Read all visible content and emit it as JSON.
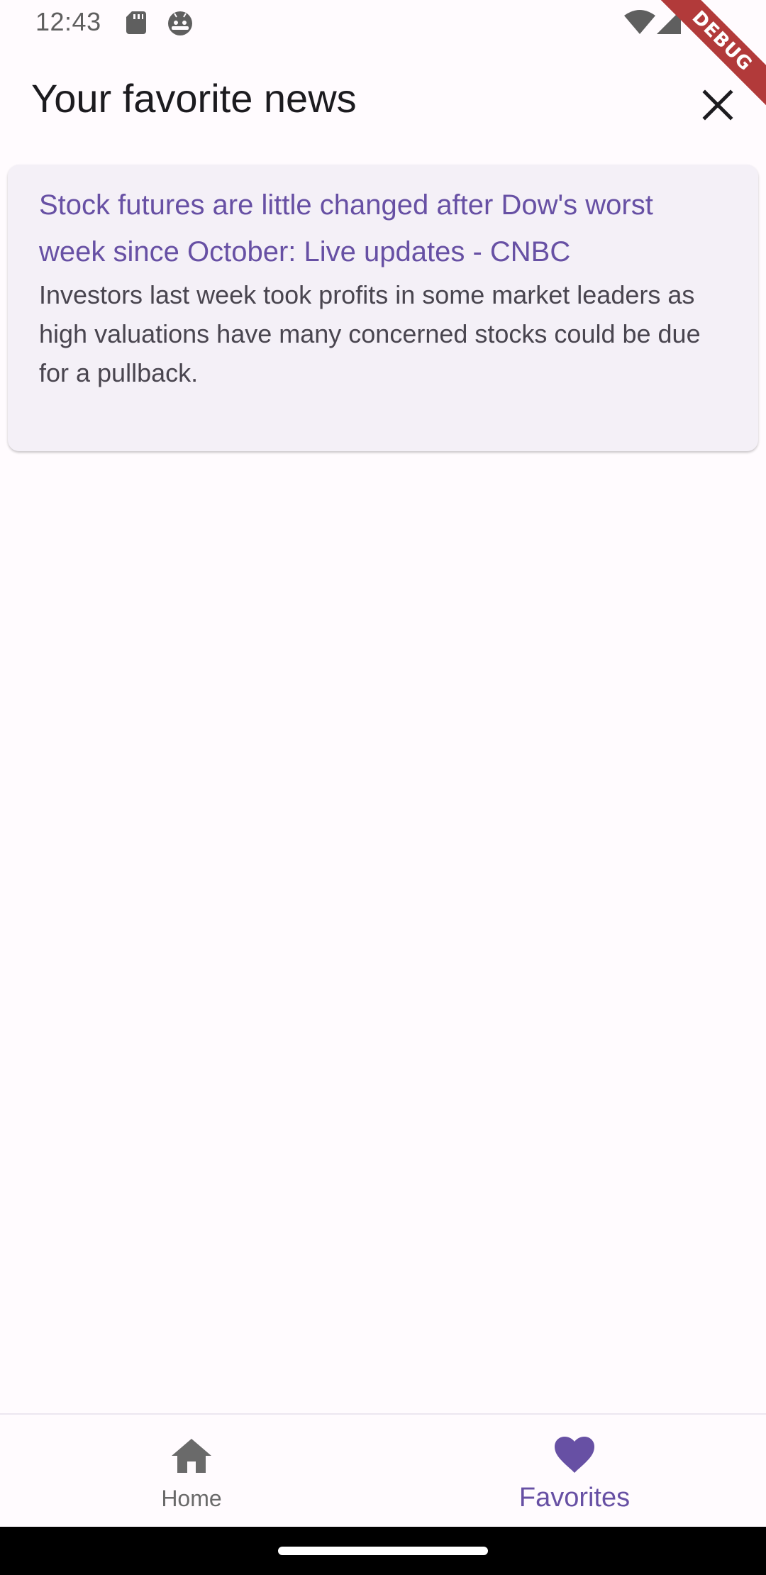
{
  "status_bar": {
    "time": "12:43",
    "icons": [
      "sd-card-icon",
      "android-icon",
      "wifi-icon",
      "signal-icon",
      "battery-icon"
    ]
  },
  "debug_banner": {
    "label": "DEBUG"
  },
  "app_bar": {
    "title": "Your favorite news",
    "close_icon": "close-icon"
  },
  "favorites": [
    {
      "title": "Stock futures are little changed after Dow's worst week since October: Live updates - CNBC",
      "description": "Investors last week took profits in some market leaders as high valuations have many concerned stocks could be due for a pullback."
    }
  ],
  "bottom_nav": {
    "items": [
      {
        "label": "Home",
        "icon": "home-icon",
        "selected": false
      },
      {
        "label": "Favorites",
        "icon": "heart-icon",
        "selected": true
      }
    ]
  },
  "colors": {
    "primary": "#6750A4",
    "background": "#FFFBFE",
    "card": "#F4F0F7",
    "text_secondary": "#49454F",
    "debug": "#B23A3A"
  }
}
